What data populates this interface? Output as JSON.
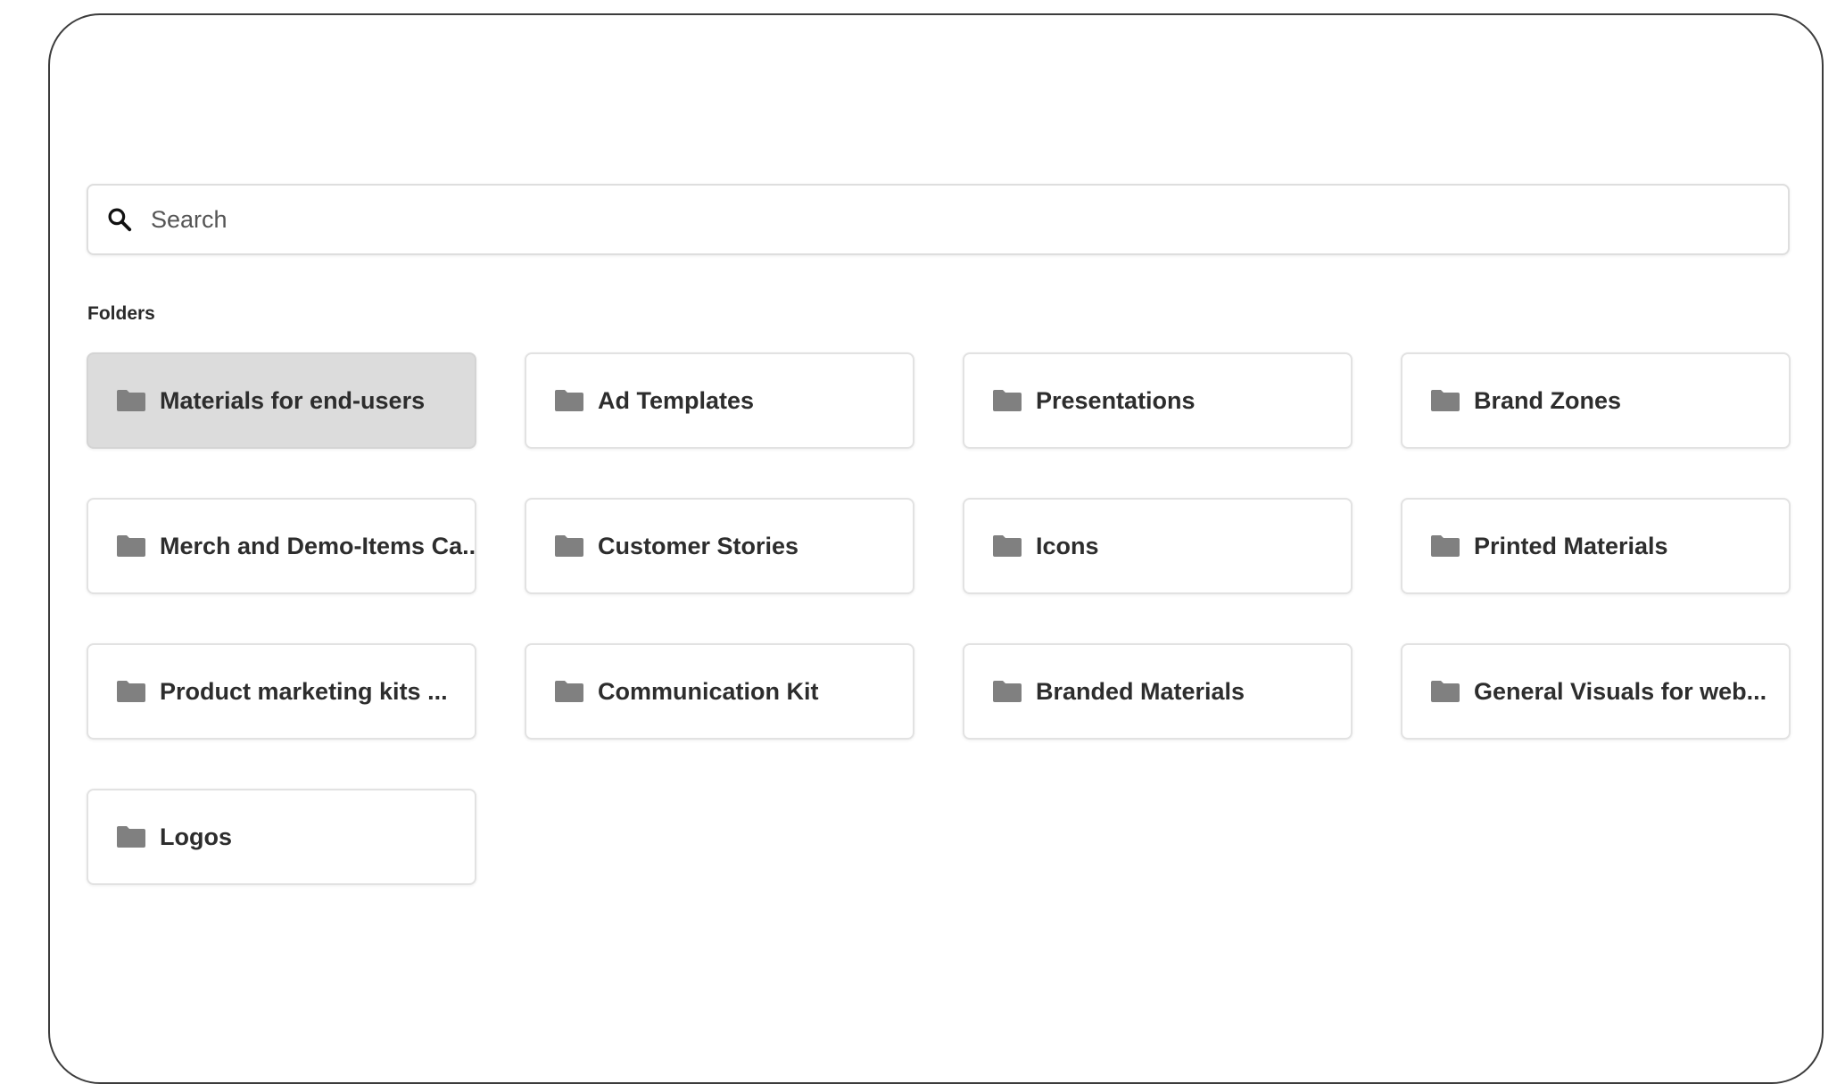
{
  "search": {
    "placeholder": "Search",
    "icon": "search-icon"
  },
  "folders_section": {
    "label": "Folders",
    "selected_index": 0,
    "items": [
      {
        "label": "Materials for end-users",
        "icon": "folder-icon"
      },
      {
        "label": "Ad Templates",
        "icon": "folder-icon"
      },
      {
        "label": "Presentations",
        "icon": "folder-icon"
      },
      {
        "label": "Brand Zones",
        "icon": "folder-icon"
      },
      {
        "label": "Merch and Demo-Items Ca...",
        "icon": "folder-icon"
      },
      {
        "label": "Customer Stories",
        "icon": "folder-icon"
      },
      {
        "label": "Icons",
        "icon": "folder-icon"
      },
      {
        "label": "Printed Materials",
        "icon": "folder-icon"
      },
      {
        "label": "Product marketing kits ...",
        "icon": "folder-icon"
      },
      {
        "label": "Communication Kit",
        "icon": "folder-icon"
      },
      {
        "label": "Branded Materials",
        "icon": "folder-icon"
      },
      {
        "label": "General Visuals for web...",
        "icon": "folder-icon"
      },
      {
        "label": "Logos",
        "icon": "folder-icon"
      }
    ]
  },
  "colors": {
    "frame_border": "#3c3c3c",
    "selected_background": "#dcdcdc",
    "folder_icon": "#808080",
    "card_border": "#e2e2e2"
  }
}
